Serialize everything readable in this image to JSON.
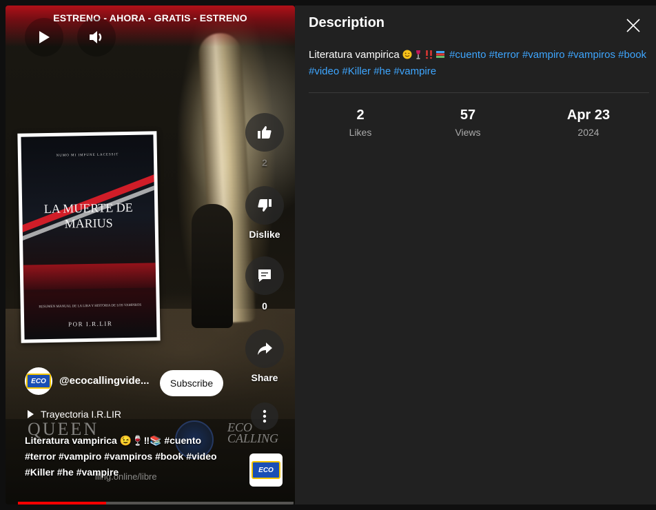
{
  "video": {
    "banner": "ESTRENO - AHORA - GRATIS - ESTRENO",
    "book": {
      "top_line": "NUMO MI IMPUNE LACESSIT",
      "title": "LA MUERTE DE MARIUS",
      "subtitle": "RESUMEN MANUAL DE LA LIRA Y HISTORIA DE LOS VAMPIROS",
      "author": "POR I.R.LIR"
    },
    "actions": {
      "like_count": "2",
      "dislike_label": "Dislike",
      "comment_count": "0",
      "share_label": "Share"
    },
    "channel_name": "@ecocallingvide...",
    "avatar_logo": "ECO",
    "subscribe_label": "Subscribe",
    "playlist": "Trayectoria I.R.LIR",
    "watermark": {
      "queen": "QUEEN",
      "eco": "ECO CALLING"
    },
    "caption": "Literatura vampirica 😉🍷‼📚 #cuento #terror #vampiro #vampiros #book #video #Killer #he #vampire",
    "url_overlay": "lling.online/libre",
    "progress": 0.32
  },
  "description": {
    "title": "Description",
    "text_plain": "Literatura vampirica",
    "tags": "#cuento #terror #vampiro #vampiros #book #video #Killer #he #vampire",
    "stats": [
      {
        "value": "2",
        "label": "Likes"
      },
      {
        "value": "57",
        "label": "Views"
      },
      {
        "value": "Apr 23",
        "label": "2024"
      }
    ]
  },
  "icons": {
    "play": "play-icon",
    "volume": "volume-icon",
    "like": "thumbs-up-icon",
    "dislike": "thumbs-down-icon",
    "comment": "comment-icon",
    "share": "share-icon",
    "more": "more-icon",
    "close": "close-icon"
  },
  "colors": {
    "accent": "#3ea6ff",
    "progress": "#ff0000",
    "panel": "#212121"
  }
}
